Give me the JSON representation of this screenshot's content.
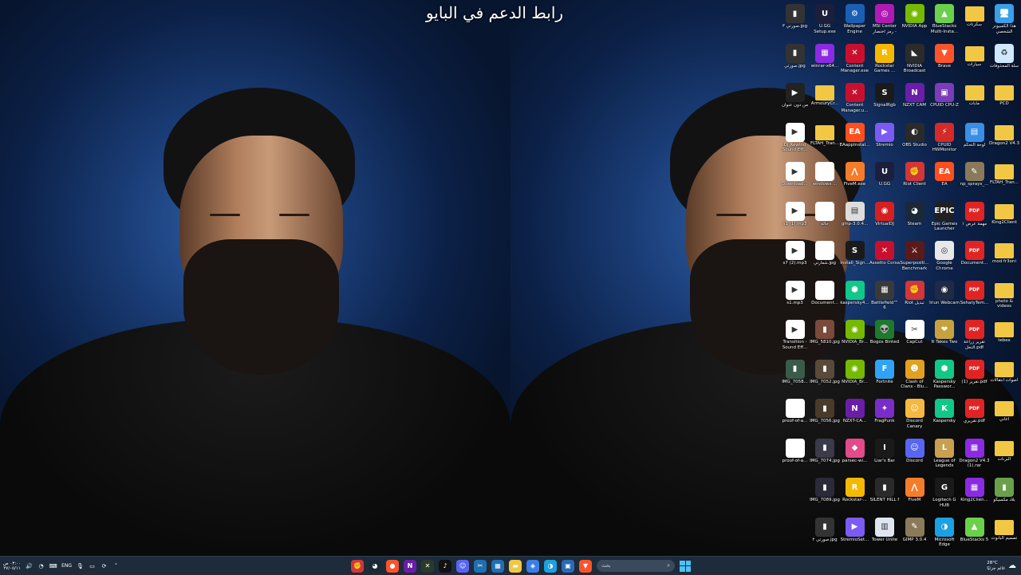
{
  "wallpaper": {
    "caption": "رابط الدعم في البايو"
  },
  "desktop_icons": [
    {
      "label": "هذا الكمبيوتر الشخصي",
      "icon": "this-pc-icon",
      "color": "#3aa0e8",
      "glyph": "🖥",
      "col": 0,
      "row": 0
    },
    {
      "label": "سكرتات",
      "icon": "folder-icon",
      "color": "#f2c744",
      "glyph": "",
      "col": 1,
      "row": 0
    },
    {
      "label": "BlueStacks Multi-Insta...",
      "icon": "bluestacks-icon",
      "color": "#6bd04a",
      "glyph": "▲",
      "col": 2,
      "row": 0
    },
    {
      "label": "NVIDIA App",
      "icon": "nvidia-icon",
      "color": "#76b900",
      "glyph": "◉",
      "col": 3,
      "row": 0
    },
    {
      "label": "MSI Center رمز اختصار -",
      "icon": "msi-center-icon",
      "color": "#b01ab3",
      "glyph": "◎",
      "col": 4,
      "row": 0
    },
    {
      "label": "Wallpaper Engine",
      "icon": "wallpaper-engine-icon",
      "color": "#1a5fb4",
      "glyph": "⚙",
      "col": 5,
      "row": 0
    },
    {
      "label": "U.GG Setup.exe",
      "icon": "ugg-icon",
      "color": "#1b1f3b",
      "glyph": "U",
      "col": 6,
      "row": 0
    },
    {
      "label": "صورتي ٣.jpg",
      "icon": "image-icon",
      "color": "#333333",
      "glyph": "▮",
      "col": 7,
      "row": 0
    },
    {
      "label": "سلة المحذوفات",
      "icon": "recycle-bin-icon",
      "color": "#cfe8ff",
      "glyph": "♻",
      "col": 0,
      "row": 1
    },
    {
      "label": "سيارات",
      "icon": "folder-icon",
      "color": "#f2c744",
      "glyph": "",
      "col": 1,
      "row": 1
    },
    {
      "label": "Brave",
      "icon": "brave-icon",
      "color": "#fb542b",
      "glyph": "▼",
      "col": 2,
      "row": 1
    },
    {
      "label": "NVIDIA Broadcast",
      "icon": "nvidia-broadcast-icon",
      "color": "#2b2b2b",
      "glyph": "◣",
      "col": 3,
      "row": 1
    },
    {
      "label": "Rockstar Games ...",
      "icon": "rockstar-icon",
      "color": "#f5b800",
      "glyph": "R",
      "col": 4,
      "row": 1
    },
    {
      "label": "Content Manager.exe",
      "icon": "content-manager-icon",
      "color": "#c8102e",
      "glyph": "✕",
      "col": 5,
      "row": 1
    },
    {
      "label": "winrar-x64...",
      "icon": "winrar-icon",
      "color": "#8a2be2",
      "glyph": "▦",
      "col": 6,
      "row": 1
    },
    {
      "label": "صورتي.jpg",
      "icon": "image-icon",
      "color": "#333333",
      "glyph": "▮",
      "col": 7,
      "row": 1
    },
    {
      "label": "PCD",
      "icon": "folder-icon",
      "color": "#f2c744",
      "glyph": "",
      "col": 0,
      "row": 2
    },
    {
      "label": "مابات",
      "icon": "folder-icon",
      "color": "#f2c744",
      "glyph": "",
      "col": 1,
      "row": 2
    },
    {
      "label": "CPUID CPU-Z",
      "icon": "cpuz-icon",
      "color": "#7a3cb8",
      "glyph": "▣",
      "col": 2,
      "row": 2
    },
    {
      "label": "NZXT CAM",
      "icon": "nzxt-cam-icon",
      "color": "#6a1ea8",
      "glyph": "N",
      "col": 3,
      "row": 2
    },
    {
      "label": "SignalRgb",
      "icon": "signalrgb-icon",
      "color": "#1a1a1a",
      "glyph": "S",
      "col": 4,
      "row": 2
    },
    {
      "label": "Content Manager.u...",
      "icon": "content-manager-icon",
      "color": "#c8102e",
      "glyph": "✕",
      "col": 5,
      "row": 2
    },
    {
      "label": "ArmouryCr...",
      "icon": "folder-icon",
      "color": "#f2c744",
      "glyph": "",
      "col": 6,
      "row": 2
    },
    {
      "label": "من دون عنوان",
      "icon": "video-icon",
      "color": "#222222",
      "glyph": "▶",
      "col": 7,
      "row": 2
    },
    {
      "label": "Dragon2 V4.3",
      "icon": "folder-icon",
      "color": "#f2c744",
      "glyph": "",
      "col": 0,
      "row": 3
    },
    {
      "label": "لوحة التحكم",
      "icon": "control-panel-icon",
      "color": "#3a8ee6",
      "glyph": "▤",
      "col": 1,
      "row": 3
    },
    {
      "label": "CPUID HWMonitor",
      "icon": "hwmonitor-icon",
      "color": "#d42a2a",
      "glyph": "⚡",
      "col": 2,
      "row": 3
    },
    {
      "label": "OBS Studio",
      "icon": "obs-icon",
      "color": "#2a2a2a",
      "glyph": "◐",
      "col": 3,
      "row": 3
    },
    {
      "label": "Stremio",
      "icon": "stremio-icon",
      "color": "#7b5bf2",
      "glyph": "▶",
      "col": 4,
      "row": 3
    },
    {
      "label": "EAappInstal...",
      "icon": "ea-icon",
      "color": "#ff4f1f",
      "glyph": "EA",
      "col": 5,
      "row": 3
    },
    {
      "label": "FLTAH_Tran...",
      "icon": "folder-icon",
      "color": "#f2c744",
      "glyph": "",
      "col": 6,
      "row": 3
    },
    {
      "label": "Dj Rewind Sound Eff...",
      "icon": "audio-file-icon",
      "color": "#ffffff",
      "glyph": "▶",
      "col": 7,
      "row": 3
    },
    {
      "label": "FLTAH_Tran...",
      "icon": "folder-icon",
      "color": "#f2c744",
      "glyph": "",
      "col": 0,
      "row": 4
    },
    {
      "label": "np_sprays_...",
      "icon": "gimp-icon",
      "color": "#8a7a5a",
      "glyph": "✎",
      "col": 1,
      "row": 4
    },
    {
      "label": "EA",
      "icon": "ea-icon",
      "color": "#ff4f1f",
      "glyph": "EA",
      "col": 2,
      "row": 4
    },
    {
      "label": "Riot Client",
      "icon": "riot-icon",
      "color": "#d13639",
      "glyph": "✊",
      "col": 3,
      "row": 4
    },
    {
      "label": "U.GG",
      "icon": "ugg-icon",
      "color": "#1b1f3b",
      "glyph": "U",
      "col": 4,
      "row": 4
    },
    {
      "label": "FiveM.exe",
      "icon": "fivem-icon",
      "color": "#f47c2b",
      "glyph": "⋀",
      "col": 5,
      "row": 4
    },
    {
      "label": "windows ...",
      "icon": "document-icon",
      "color": "#ffffff",
      "glyph": "",
      "col": 6,
      "row": 4
    },
    {
      "label": "Download...",
      "icon": "audio-file-icon",
      "color": "#ffffff",
      "glyph": "▶",
      "col": 7,
      "row": 4
    },
    {
      "label": "King2Client",
      "icon": "folder-icon",
      "color": "#f2c744",
      "glyph": "",
      "col": 0,
      "row": 5
    },
    {
      "label": "مهمة عرض ١",
      "icon": "pdf-icon",
      "color": "#e02424",
      "glyph": "PDF",
      "col": 1,
      "row": 5
    },
    {
      "label": "Epic Games Launcher",
      "icon": "epic-games-icon",
      "color": "#202020",
      "glyph": "EPIC",
      "col": 2,
      "row": 5
    },
    {
      "label": "Steam",
      "icon": "steam-icon",
      "color": "#1b2838",
      "glyph": "◕",
      "col": 3,
      "row": 5
    },
    {
      "label": "VirtualDJ",
      "icon": "virtualdj-icon",
      "color": "#d62020",
      "glyph": "◉",
      "col": 4,
      "row": 5
    },
    {
      "label": "gmp-3.0.4...",
      "icon": "installer-icon",
      "color": "#dddddd",
      "glyph": "▤",
      "col": 5,
      "row": 5
    },
    {
      "label": "حالة",
      "icon": "document-icon",
      "color": "#ffffff",
      "glyph": "",
      "col": 6,
      "row": 5
    },
    {
      "label": "s1 (1).mp3",
      "icon": "audio-file-icon",
      "color": "#ffffff",
      "glyph": "▶",
      "col": 7,
      "row": 5
    },
    {
      "label": "mod fr3oni",
      "icon": "folder-icon",
      "color": "#f2c744",
      "glyph": "",
      "col": 0,
      "row": 6
    },
    {
      "label": "Document...",
      "icon": "pdf-icon",
      "color": "#e02424",
      "glyph": "PDF",
      "col": 1,
      "row": 6
    },
    {
      "label": "Google Chrome",
      "icon": "chrome-icon",
      "color": "#e8e8e8",
      "glyph": "◎",
      "col": 2,
      "row": 6
    },
    {
      "label": "Superpositi... Benchmark",
      "icon": "superposition-icon",
      "color": "#5a1a1a",
      "glyph": "⚔",
      "col": 3,
      "row": 6
    },
    {
      "label": "Assetto Corsa",
      "icon": "assetto-corsa-icon",
      "color": "#c8102e",
      "glyph": "✕",
      "col": 4,
      "row": 6
    },
    {
      "label": "Install_Sign...",
      "icon": "signalrgb-icon",
      "color": "#1a1a1a",
      "glyph": "S",
      "col": 5,
      "row": 6
    },
    {
      "label": "شعارتي.jpg",
      "icon": "document-icon",
      "color": "#ffffff",
      "glyph": "",
      "col": 6,
      "row": 6
    },
    {
      "label": "s7 (2).mp3",
      "icon": "audio-file-icon",
      "color": "#ffffff",
      "glyph": "▶",
      "col": 7,
      "row": 6
    },
    {
      "label": "photo & videos",
      "icon": "folder-icon",
      "color": "#f2c744",
      "glyph": "",
      "col": 0,
      "row": 7
    },
    {
      "label": "SehatyTem...",
      "icon": "pdf-icon",
      "color": "#e02424",
      "glyph": "PDF",
      "col": 1,
      "row": 7
    },
    {
      "label": "Iriun Webcam",
      "icon": "iriun-icon",
      "color": "#202a44",
      "glyph": "◉",
      "col": 2,
      "row": 7
    },
    {
      "label": "Riot تبديل",
      "icon": "riot-icon",
      "color": "#d13639",
      "glyph": "✊",
      "col": 3,
      "row": 7
    },
    {
      "label": "Battlefield™ 6",
      "icon": "battlefield-icon",
      "color": "#3a3a3a",
      "glyph": "▦",
      "col": 4,
      "row": 7
    },
    {
      "label": "kaspersky4...",
      "icon": "kaspersky-icon",
      "color": "#10c888",
      "glyph": "⬢",
      "col": 5,
      "row": 7
    },
    {
      "label": "Document...",
      "icon": "document-icon",
      "color": "#ffffff",
      "glyph": "",
      "col": 6,
      "row": 7
    },
    {
      "label": "s1.mp3",
      "icon": "audio-file-icon",
      "color": "#ffffff",
      "glyph": "▶",
      "col": 7,
      "row": 7
    },
    {
      "label": "tebex",
      "icon": "folder-icon",
      "color": "#f2c744",
      "glyph": "",
      "col": 0,
      "row": 8
    },
    {
      "label": "تقرير زراعة النخل.pdf",
      "icon": "pdf-icon",
      "color": "#e02424",
      "glyph": "PDF",
      "col": 1,
      "row": 8
    },
    {
      "label": "It Takes Two",
      "icon": "it-takes-two-icon",
      "color": "#c7a23c",
      "glyph": "❤",
      "col": 2,
      "row": 8
    },
    {
      "label": "CapCut",
      "icon": "capcut-icon",
      "color": "#ffffff",
      "glyph": "✂",
      "col": 3,
      "row": 8
    },
    {
      "label": "Bogos Binted",
      "icon": "alien-icon",
      "color": "#1e7a2a",
      "glyph": "👽",
      "col": 4,
      "row": 8
    },
    {
      "label": "NVIDIA_Br...",
      "icon": "nvidia-icon",
      "color": "#76b900",
      "glyph": "◉",
      "col": 5,
      "row": 8
    },
    {
      "label": "IMG_5810.jpg",
      "icon": "image-icon",
      "color": "#7a4a3a",
      "glyph": "▮",
      "col": 6,
      "row": 8
    },
    {
      "label": "Transition - Sound Eff...",
      "icon": "audio-file-icon",
      "color": "#ffffff",
      "glyph": "▶",
      "col": 7,
      "row": 8
    },
    {
      "label": "اصوات انتقالات",
      "icon": "folder-icon",
      "color": "#f2c744",
      "glyph": "",
      "col": 0,
      "row": 9
    },
    {
      "label": "تقرير (1).pdf",
      "icon": "pdf-icon",
      "color": "#e02424",
      "glyph": "PDF",
      "col": 1,
      "row": 9
    },
    {
      "label": "Kaspersky Passwor...",
      "icon": "kaspersky-icon",
      "color": "#10c888",
      "glyph": "⬢",
      "col": 2,
      "row": 9
    },
    {
      "label": "Clash of Clans - Blu...",
      "icon": "clash-icon",
      "color": "#e0a020",
      "glyph": "☻",
      "col": 3,
      "row": 9
    },
    {
      "label": "Fortnite",
      "icon": "fortnite-icon",
      "color": "#2fa3f5",
      "glyph": "F",
      "col": 4,
      "row": 9
    },
    {
      "label": "NVIDIA_Br...",
      "icon": "nvidia-icon",
      "color": "#76b900",
      "glyph": "◉",
      "col": 5,
      "row": 9
    },
    {
      "label": "IMG_7052.jpg",
      "icon": "image-icon",
      "color": "#5a4a3a",
      "glyph": "▮",
      "col": 6,
      "row": 9
    },
    {
      "label": "IMG_7058...",
      "icon": "image-icon",
      "color": "#3a5a4a",
      "glyph": "▮",
      "col": 7,
      "row": 9
    },
    {
      "label": "اغاني",
      "icon": "folder-icon",
      "color": "#f2c744",
      "glyph": "",
      "col": 0,
      "row": 10
    },
    {
      "label": "تقريري.pdf",
      "icon": "pdf-icon",
      "color": "#e02424",
      "glyph": "PDF",
      "col": 1,
      "row": 10
    },
    {
      "label": "Kaspersky",
      "icon": "kaspersky-icon",
      "color": "#10c888",
      "glyph": "K",
      "col": 2,
      "row": 10
    },
    {
      "label": "Discord Canary",
      "icon": "discord-canary-icon",
      "color": "#f5b840",
      "glyph": "☺",
      "col": 3,
      "row": 10
    },
    {
      "label": "FragPunk",
      "icon": "fragpunk-icon",
      "color": "#7a2cc8",
      "glyph": "✦",
      "col": 4,
      "row": 10
    },
    {
      "label": "NZXT-CA...",
      "icon": "nzxt-cam-icon",
      "color": "#6a1ea8",
      "glyph": "N",
      "col": 5,
      "row": 10
    },
    {
      "label": "IMG_7056.jpg",
      "icon": "image-icon",
      "color": "#4a3a2a",
      "glyph": "▮",
      "col": 6,
      "row": 10
    },
    {
      "label": "proof-of-a...",
      "icon": "document-icon",
      "color": "#ffffff",
      "glyph": "",
      "col": 7,
      "row": 10
    },
    {
      "label": "البرنات",
      "icon": "folder-icon",
      "color": "#f2c744",
      "glyph": "",
      "col": 0,
      "row": 11
    },
    {
      "label": "Dragon2 V4.3 (1).rar",
      "icon": "winrar-icon",
      "color": "#8a2be2",
      "glyph": "▦",
      "col": 1,
      "row": 11
    },
    {
      "label": "League of Legends",
      "icon": "league-icon",
      "color": "#c8a050",
      "glyph": "L",
      "col": 2,
      "row": 11
    },
    {
      "label": "Discord",
      "icon": "discord-icon",
      "color": "#5865f2",
      "glyph": "☺",
      "col": 3,
      "row": 11
    },
    {
      "label": "Liar's Bar",
      "icon": "liars-bar-icon",
      "color": "#1a1a1a",
      "glyph": "I",
      "col": 4,
      "row": 11
    },
    {
      "label": "parsec-wi...",
      "icon": "parsec-icon",
      "color": "#e24a8a",
      "glyph": "◆",
      "col": 5,
      "row": 11
    },
    {
      "label": "IMG_7074.jpg",
      "icon": "image-icon",
      "color": "#3a3a4a",
      "glyph": "▮",
      "col": 6,
      "row": 11
    },
    {
      "label": "proof-of-a...",
      "icon": "document-icon",
      "color": "#ffffff",
      "glyph": "",
      "col": 7,
      "row": 11
    },
    {
      "label": "بلاد مكسيكو",
      "icon": "image-icon",
      "color": "#6aa04a",
      "glyph": "▮",
      "col": 0,
      "row": 12
    },
    {
      "label": "King2Clien...",
      "icon": "winrar-icon",
      "color": "#8a2be2",
      "glyph": "▦",
      "col": 1,
      "row": 12
    },
    {
      "label": "Logitech G HUB",
      "icon": "logitech-icon",
      "color": "#1a1a1a",
      "glyph": "G",
      "col": 2,
      "row": 12
    },
    {
      "label": "FiveM",
      "icon": "fivem-icon",
      "color": "#f47c2b",
      "glyph": "⋀",
      "col": 3,
      "row": 12
    },
    {
      "label": "SILENT HILL f",
      "icon": "silent-hill-icon",
      "color": "#2a2a2a",
      "glyph": "▮",
      "col": 4,
      "row": 12
    },
    {
      "label": "Rockstar-...",
      "icon": "rockstar-icon",
      "color": "#f5b800",
      "glyph": "R",
      "col": 5,
      "row": 12
    },
    {
      "label": "IMG_7089.jpg",
      "icon": "image-icon",
      "color": "#2a2a3a",
      "glyph": "▮",
      "col": 6,
      "row": 12
    },
    {
      "label": "تصميم البانوت",
      "icon": "folder-icon",
      "color": "#f2c744",
      "glyph": "",
      "col": 0,
      "row": 13
    },
    {
      "label": "BlueStacks 5",
      "icon": "bluestacks-icon",
      "color": "#6bd04a",
      "glyph": "▲",
      "col": 1,
      "row": 13
    },
    {
      "label": "Microsoft Edge",
      "icon": "edge-icon",
      "color": "#1ba1e2",
      "glyph": "◑",
      "col": 2,
      "row": 13
    },
    {
      "label": "GIMP 3.0.4",
      "icon": "gimp-icon",
      "color": "#8a7a5a",
      "glyph": "✎",
      "col": 3,
      "row": 13
    },
    {
      "label": "Tower Unite",
      "icon": "tower-unite-icon",
      "color": "#dfe6f2",
      "glyph": "▥",
      "col": 4,
      "row": 13
    },
    {
      "label": "StremioSet...",
      "icon": "stremio-icon",
      "color": "#7b5bf2",
      "glyph": "▶",
      "col": 5,
      "row": 13
    },
    {
      "label": "صورتي ٢.jpg",
      "icon": "image-icon",
      "color": "#333333",
      "glyph": "▮",
      "col": 6,
      "row": 13
    }
  ],
  "taskbar": {
    "clock_time": "٠٣:٠٠ ص",
    "clock_date": "٢٧/٠٥/١١",
    "language": "ENG",
    "search_placeholder": "بحث",
    "weather_temp": "28°C",
    "weather_desc": "غائم جزئيًا",
    "pinned_apps": [
      {
        "name": "riot-client-icon",
        "color": "#d13639",
        "glyph": "✊"
      },
      {
        "name": "steam-icon",
        "color": "#1b2838",
        "glyph": "◕"
      },
      {
        "name": "brave-icon",
        "color": "#fb542b",
        "glyph": "●"
      },
      {
        "name": "nzxt-cam-icon",
        "color": "#6a1ea8",
        "glyph": "N"
      },
      {
        "name": "xbox-icon",
        "color": "#2a3a2a",
        "glyph": "✕"
      },
      {
        "name": "tiktok-icon",
        "color": "#111111",
        "glyph": "♪"
      },
      {
        "name": "discord-icon",
        "color": "#5865f2",
        "glyph": "☺"
      },
      {
        "name": "snipping-tool-icon",
        "color": "#1f6fb2",
        "glyph": "✂"
      },
      {
        "name": "calendar-app-icon",
        "color": "#1f6fb2",
        "glyph": "▦"
      },
      {
        "name": "file-explorer-icon",
        "color": "#f2c744",
        "glyph": "▬"
      },
      {
        "name": "copilot-icon",
        "color": "#3a7ee8",
        "glyph": "◈"
      },
      {
        "name": "edge-icon",
        "color": "#1ba1e2",
        "glyph": "◑"
      },
      {
        "name": "store-icon",
        "color": "#2a6ab8",
        "glyph": "▣"
      },
      {
        "name": "brave-icon",
        "color": "#fb542b",
        "glyph": "▼"
      }
    ]
  }
}
